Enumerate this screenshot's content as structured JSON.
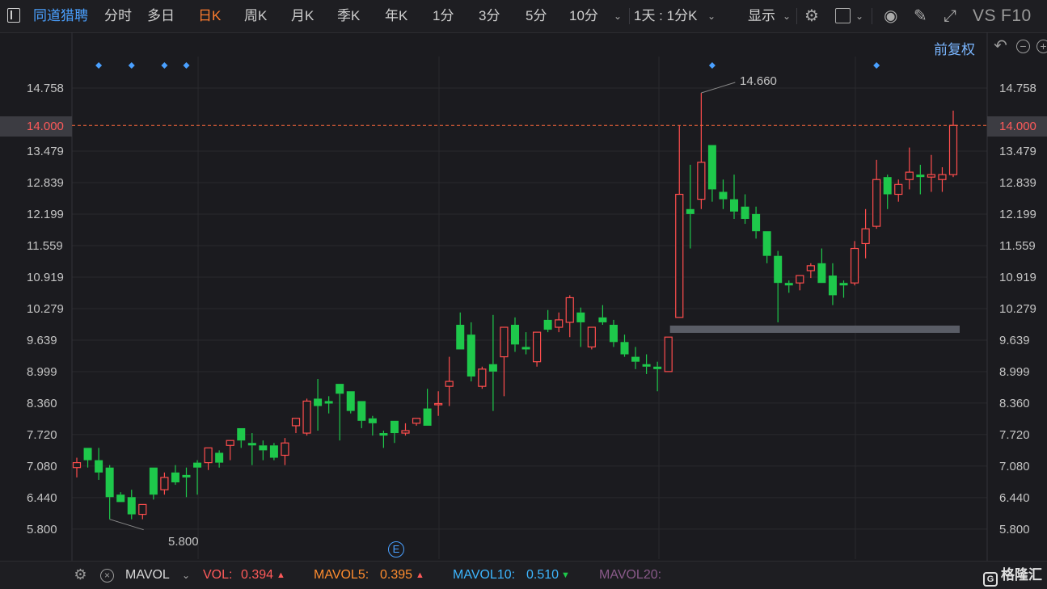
{
  "toolbar": {
    "stock_name": "同道猎聘",
    "periods": [
      "分时",
      "多日",
      "日K",
      "周K",
      "月K",
      "季K",
      "年K",
      "1分",
      "3分",
      "5分",
      "10分"
    ],
    "active_period": "日K",
    "interval_combo": "1天 : 1分K",
    "display_label": "显示",
    "vs_label": "VS",
    "f10_label": "F10"
  },
  "adjust_label": "前复权",
  "price_axis": {
    "labels": [
      "14.758",
      "13.479",
      "12.839",
      "12.199",
      "11.559",
      "10.919",
      "10.279",
      "9.639",
      "8.999",
      "8.360",
      "7.720",
      "7.080",
      "6.440",
      "5.800"
    ],
    "current_price": "14.000",
    "high_marker": "14.660",
    "low_marker": "5.800"
  },
  "colors": {
    "up": "#ff4d4d",
    "down": "#1ec84b",
    "accent": "#ff7d2e",
    "link": "#4aa0ff"
  },
  "e_badge": "E",
  "indicator_bar": {
    "name": "MAVOL",
    "vol_label": "VOL:",
    "vol_value": "0.394",
    "mavol5_label": "MAVOL5:",
    "mavol5_value": "0.395",
    "mavol10_label": "MAVOL10:",
    "mavol10_value": "0.510",
    "mavol20_label": "MAVOL20:"
  },
  "brand": "格隆汇",
  "chart_data": {
    "type": "candlestick",
    "ylim": [
      5.5,
      15.3
    ],
    "candles": [
      {
        "o": 7.05,
        "h": 7.25,
        "l": 6.85,
        "c": 7.15
      },
      {
        "o": 7.45,
        "h": 7.45,
        "l": 7.05,
        "c": 7.2
      },
      {
        "o": 7.2,
        "h": 7.45,
        "l": 6.8,
        "c": 6.95
      },
      {
        "o": 7.05,
        "h": 7.1,
        "l": 6.0,
        "c": 6.45
      },
      {
        "o": 6.5,
        "h": 6.55,
        "l": 6.35,
        "c": 6.35
      },
      {
        "o": 6.45,
        "h": 6.6,
        "l": 6.0,
        "c": 6.1
      },
      {
        "o": 6.1,
        "h": 6.3,
        "l": 6.0,
        "c": 6.3
      },
      {
        "o": 7.05,
        "h": 7.05,
        "l": 6.4,
        "c": 6.5
      },
      {
        "o": 6.6,
        "h": 6.95,
        "l": 6.5,
        "c": 6.85
      },
      {
        "o": 6.95,
        "h": 7.1,
        "l": 6.7,
        "c": 6.75
      },
      {
        "o": 6.9,
        "h": 7.05,
        "l": 6.45,
        "c": 6.85
      },
      {
        "o": 7.15,
        "h": 7.2,
        "l": 6.5,
        "c": 7.05
      },
      {
        "o": 7.15,
        "h": 7.45,
        "l": 7.0,
        "c": 7.45
      },
      {
        "o": 7.35,
        "h": 7.4,
        "l": 7.05,
        "c": 7.15
      },
      {
        "o": 7.5,
        "h": 7.6,
        "l": 7.2,
        "c": 7.6
      },
      {
        "o": 7.85,
        "h": 7.85,
        "l": 7.45,
        "c": 7.6
      },
      {
        "o": 7.55,
        "h": 7.75,
        "l": 7.1,
        "c": 7.5
      },
      {
        "o": 7.5,
        "h": 7.6,
        "l": 7.2,
        "c": 7.4
      },
      {
        "o": 7.5,
        "h": 7.55,
        "l": 7.2,
        "c": 7.25
      },
      {
        "o": 7.3,
        "h": 7.65,
        "l": 7.1,
        "c": 7.55
      },
      {
        "o": 7.9,
        "h": 8.0,
        "l": 7.75,
        "c": 8.05
      },
      {
        "o": 7.75,
        "h": 8.45,
        "l": 7.7,
        "c": 8.4
      },
      {
        "o": 8.45,
        "h": 8.85,
        "l": 7.8,
        "c": 8.3
      },
      {
        "o": 8.4,
        "h": 8.5,
        "l": 8.15,
        "c": 8.35
      },
      {
        "o": 8.75,
        "h": 8.75,
        "l": 7.6,
        "c": 8.55
      },
      {
        "o": 8.6,
        "h": 8.6,
        "l": 8.15,
        "c": 8.2
      },
      {
        "o": 8.4,
        "h": 8.4,
        "l": 7.85,
        "c": 8.0
      },
      {
        "o": 8.05,
        "h": 8.1,
        "l": 7.7,
        "c": 7.95
      },
      {
        "o": 7.75,
        "h": 7.8,
        "l": 7.45,
        "c": 7.7
      },
      {
        "o": 8.0,
        "h": 8.0,
        "l": 7.55,
        "c": 7.75
      },
      {
        "o": 7.75,
        "h": 7.95,
        "l": 7.7,
        "c": 7.8
      },
      {
        "o": 7.95,
        "h": 8.05,
        "l": 7.9,
        "c": 8.05
      },
      {
        "o": 8.25,
        "h": 8.65,
        "l": 7.9,
        "c": 7.9
      },
      {
        "o": 8.35,
        "h": 8.6,
        "l": 8.1,
        "c": 8.35
      },
      {
        "o": 8.7,
        "h": 9.3,
        "l": 8.3,
        "c": 8.8
      },
      {
        "o": 9.95,
        "h": 10.2,
        "l": 9.45,
        "c": 9.45
      },
      {
        "o": 9.75,
        "h": 10.0,
        "l": 8.8,
        "c": 8.9
      },
      {
        "o": 8.7,
        "h": 9.1,
        "l": 8.65,
        "c": 9.05
      },
      {
        "o": 9.15,
        "h": 10.15,
        "l": 8.2,
        "c": 9.0
      },
      {
        "o": 9.3,
        "h": 9.9,
        "l": 8.5,
        "c": 9.9
      },
      {
        "o": 9.95,
        "h": 10.1,
        "l": 9.4,
        "c": 9.55
      },
      {
        "o": 9.5,
        "h": 9.8,
        "l": 9.35,
        "c": 9.45
      },
      {
        "o": 9.2,
        "h": 9.8,
        "l": 9.1,
        "c": 9.8
      },
      {
        "o": 10.05,
        "h": 10.25,
        "l": 9.8,
        "c": 9.85
      },
      {
        "o": 9.9,
        "h": 10.2,
        "l": 9.8,
        "c": 10.05
      },
      {
        "o": 10.0,
        "h": 10.55,
        "l": 9.7,
        "c": 10.5
      },
      {
        "o": 10.2,
        "h": 10.3,
        "l": 9.5,
        "c": 10.0
      },
      {
        "o": 9.5,
        "h": 9.85,
        "l": 9.45,
        "c": 9.9
      },
      {
        "o": 10.1,
        "h": 10.35,
        "l": 9.95,
        "c": 10.0
      },
      {
        "o": 9.95,
        "h": 10.05,
        "l": 9.5,
        "c": 9.6
      },
      {
        "o": 9.6,
        "h": 9.75,
        "l": 9.3,
        "c": 9.35
      },
      {
        "o": 9.3,
        "h": 9.5,
        "l": 9.05,
        "c": 9.2
      },
      {
        "o": 9.15,
        "h": 9.35,
        "l": 8.95,
        "c": 9.1
      },
      {
        "o": 9.1,
        "h": 9.2,
        "l": 8.6,
        "c": 9.05
      },
      {
        "o": 9.0,
        "h": 9.45,
        "l": 9.0,
        "c": 9.7
      },
      {
        "o": 10.1,
        "h": 14.0,
        "l": 10.1,
        "c": 12.6
      },
      {
        "o": 12.3,
        "h": 13.2,
        "l": 11.5,
        "c": 12.2
      },
      {
        "o": 12.5,
        "h": 14.66,
        "l": 12.3,
        "c": 13.25
      },
      {
        "o": 13.6,
        "h": 13.6,
        "l": 12.45,
        "c": 12.7
      },
      {
        "o": 12.65,
        "h": 12.9,
        "l": 12.3,
        "c": 12.5
      },
      {
        "o": 12.5,
        "h": 13.0,
        "l": 12.1,
        "c": 12.25
      },
      {
        "o": 12.35,
        "h": 12.6,
        "l": 12.0,
        "c": 12.1
      },
      {
        "o": 12.2,
        "h": 12.35,
        "l": 11.7,
        "c": 11.85
      },
      {
        "o": 11.85,
        "h": 11.85,
        "l": 11.2,
        "c": 11.35
      },
      {
        "o": 11.35,
        "h": 11.45,
        "l": 10.0,
        "c": 10.8
      },
      {
        "o": 10.8,
        "h": 10.85,
        "l": 10.6,
        "c": 10.75
      },
      {
        "o": 10.8,
        "h": 10.95,
        "l": 10.65,
        "c": 10.95
      },
      {
        "o": 11.05,
        "h": 11.2,
        "l": 10.9,
        "c": 11.15
      },
      {
        "o": 11.2,
        "h": 11.5,
        "l": 10.8,
        "c": 10.8
      },
      {
        "o": 10.95,
        "h": 11.2,
        "l": 10.35,
        "c": 10.55
      },
      {
        "o": 10.8,
        "h": 10.85,
        "l": 10.5,
        "c": 10.75
      },
      {
        "o": 10.8,
        "h": 11.65,
        "l": 10.75,
        "c": 11.5
      },
      {
        "o": 11.6,
        "h": 12.3,
        "l": 11.3,
        "c": 11.9
      },
      {
        "o": 11.95,
        "h": 13.3,
        "l": 11.9,
        "c": 12.9
      },
      {
        "o": 12.95,
        "h": 13.0,
        "l": 12.3,
        "c": 12.6
      },
      {
        "o": 12.6,
        "h": 12.9,
        "l": 12.45,
        "c": 12.8
      },
      {
        "o": 12.9,
        "h": 13.55,
        "l": 12.7,
        "c": 13.05
      },
      {
        "o": 13.0,
        "h": 13.2,
        "l": 12.6,
        "c": 12.95
      },
      {
        "o": 12.95,
        "h": 13.4,
        "l": 12.65,
        "c": 13.0
      },
      {
        "o": 12.9,
        "h": 13.15,
        "l": 12.65,
        "c": 13.0
      },
      {
        "o": 13.0,
        "h": 14.3,
        "l": 12.95,
        "c": 14.0
      }
    ],
    "markers": [
      2,
      5,
      8,
      10,
      58,
      73
    ],
    "horizontal_line": 14.0,
    "support_range": {
      "from": 54,
      "to": 80,
      "price": 9.86
    }
  }
}
